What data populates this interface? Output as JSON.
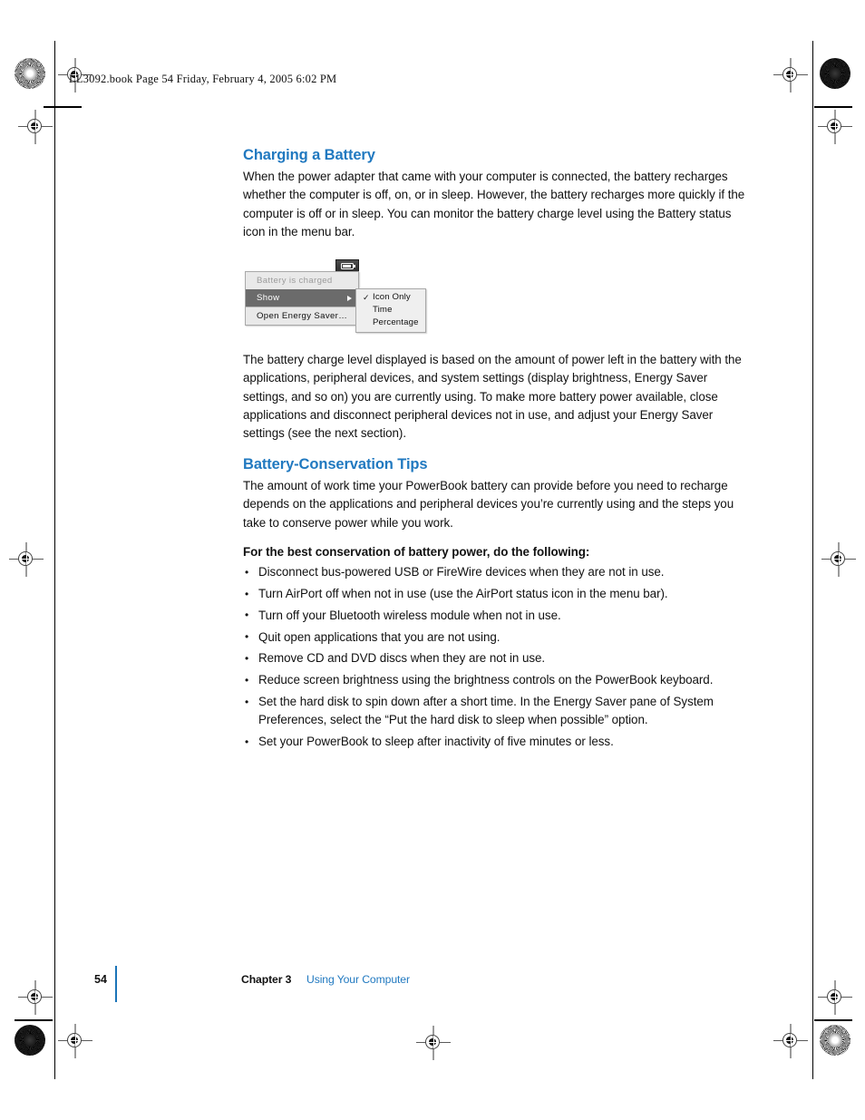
{
  "page": {
    "running_head": "LL3092.book  Page 54  Friday, February 4, 2005  6:02 PM",
    "accent_blue": "#2179c0",
    "rule_blue": "#1b74b8",
    "text_black": "#111111"
  },
  "sections": [
    {
      "heading": "Charging a Battery",
      "paragraph": "When the power adapter that came with your computer is connected, the battery recharges whether the computer is off, on, or in sleep. However, the battery recharges more quickly if the computer is off or in sleep. You can monitor the battery charge level using the Battery status icon in the menu bar."
    },
    {
      "paragraph": "The battery charge level displayed is based on the amount of power left in the battery with the applications, peripheral devices, and system settings (display brightness, Energy Saver settings, and so on) you are currently using. To make more battery power available, close applications and disconnect peripheral devices not in use, and adjust your Energy Saver settings (see the next section)."
    },
    {
      "heading": "Battery-Conservation Tips",
      "paragraph": "The amount of work time your PowerBook battery can provide before you need to recharge depends on the applications and peripheral devices you’re currently using and the steps you take to conserve power while you work."
    }
  ],
  "tips": {
    "lead": "For the best conservation of battery power, do the following:",
    "items": [
      "Disconnect bus-powered USB or FireWire devices when they are not in use.",
      "Turn AirPort off when not in use (use the AirPort status icon in the menu bar).",
      "Turn off your Bluetooth wireless module when not in use.",
      "Quit open applications that you are not using.",
      "Remove CD and DVD discs when they are not in use.",
      "Reduce screen brightness using the brightness controls on the PowerBook keyboard.",
      "Set the hard disk to spin down after a short time. In the Energy Saver pane of System Preferences, select the “Put the hard disk to sleep when possible” option.",
      "Set your PowerBook to sleep after inactivity of five minutes or less."
    ]
  },
  "menu_illustration": {
    "status_icon_name": "battery-status-icon",
    "main_items": [
      {
        "label": "Battery is charged",
        "state": "disabled"
      },
      {
        "label": "Show",
        "state": "selected",
        "has_submenu": true
      },
      {
        "label": "Open Energy Saver…",
        "state": "normal",
        "separator_above": true
      }
    ],
    "submenu_items": [
      {
        "label": "Icon Only",
        "checked": true
      },
      {
        "label": "Time",
        "checked": false
      },
      {
        "label": "Percentage",
        "checked": false
      }
    ],
    "checkmark": "✓",
    "selected_bg": "#6b6b6b",
    "menu_bg": "#e9e9e9"
  },
  "footer": {
    "page_number": "54",
    "chapter_label": "Chapter 3",
    "chapter_title": "Using Your Computer"
  }
}
